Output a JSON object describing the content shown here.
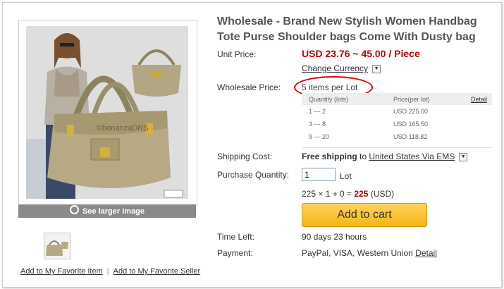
{
  "product": {
    "title": "Wholesale - Brand New Stylish Women Handbag Tote Purse Shoulder bags Come With Dusty bag",
    "image_watermark": "©bonanzaDRS"
  },
  "gallery": {
    "see_larger_label": "See larger image",
    "add_fav_item": "Add to My Favorite Item",
    "separator": "|",
    "add_fav_seller": "Add to My Favorite Seller"
  },
  "pricing": {
    "unit_price_label": "Unit Price:",
    "unit_price_value": "USD 23.76 ~ 45.00 / Piece",
    "change_currency": "Change Currency",
    "wholesale_label": "Wholesale Price:",
    "lot_text": "5 items per Lot",
    "tier_headers": {
      "quantity": "Quantity (lots)",
      "price": "Price(per lot)",
      "detail": "Detail"
    },
    "tiers": [
      {
        "qty": "1  ---  2",
        "price": "USD 225.00"
      },
      {
        "qty": "3  ---  8",
        "price": "USD 165.50"
      },
      {
        "qty": "9  ---  20",
        "price": "USD 118.82"
      }
    ]
  },
  "shipping": {
    "label": "Shipping Cost:",
    "free": "Free shipping",
    "to": "to",
    "destination": "United States Via EMS"
  },
  "purchase": {
    "label": "Purchase Quantity:",
    "quantity": "1",
    "unit": "Lot",
    "calc_prefix": "225 × 1 + 0 = ",
    "total": "225",
    "currency": "(USD)",
    "add_to_cart": "Add to cart"
  },
  "time_left": {
    "label": "Time Left:",
    "value": "90 days 23 hours"
  },
  "payment": {
    "label": "Payment:",
    "methods": "PayPal, VISA, Western Union",
    "detail_link": "Detail"
  },
  "colors": {
    "price_red": "#b30000",
    "circle_red": "#e00000",
    "cart_button": "#f5b515"
  }
}
